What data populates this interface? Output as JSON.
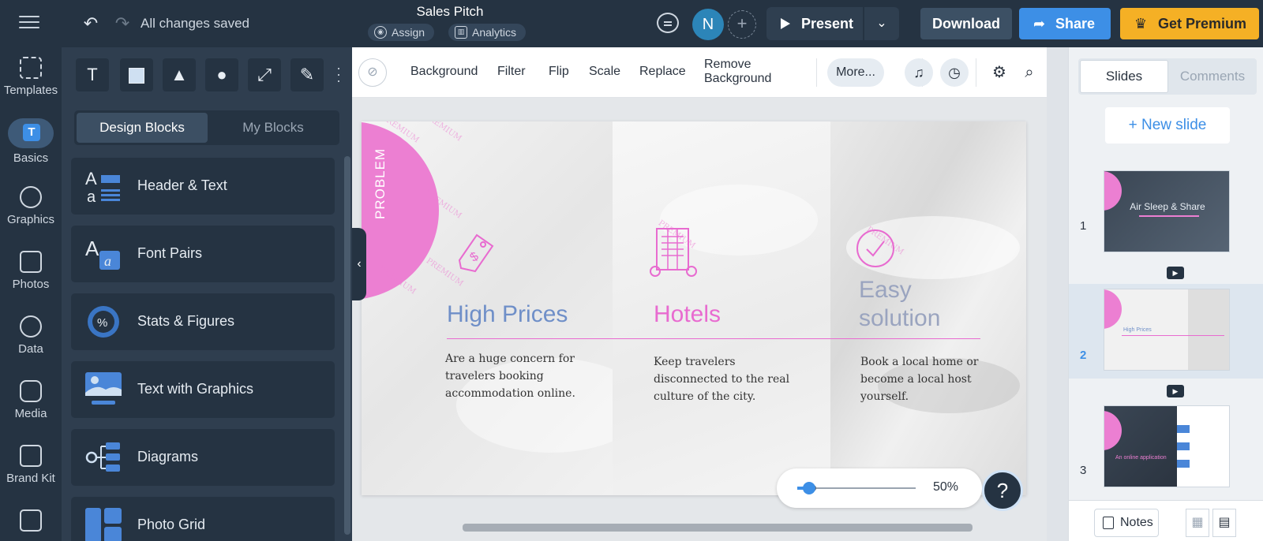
{
  "topbar": {
    "save_status": "All changes saved",
    "doc_title": "Sales Pitch",
    "assign_label": "Assign",
    "analytics_label": "Analytics",
    "avatar_initial": "N",
    "present_label": "Present",
    "download_label": "Download",
    "share_label": "Share",
    "premium_label": "Get Premium"
  },
  "leftnav": {
    "items": [
      {
        "label": "Templates"
      },
      {
        "label": "Basics"
      },
      {
        "label": "Graphics"
      },
      {
        "label": "Photos"
      },
      {
        "label": "Data"
      },
      {
        "label": "Media"
      },
      {
        "label": "Brand Kit"
      }
    ]
  },
  "panel": {
    "tab_design": "Design Blocks",
    "tab_mine": "My Blocks",
    "blocks": [
      {
        "label": "Header & Text"
      },
      {
        "label": "Font Pairs"
      },
      {
        "label": "Stats & Figures"
      },
      {
        "label": "Text with Graphics"
      },
      {
        "label": "Diagrams"
      },
      {
        "label": "Photo Grid"
      }
    ]
  },
  "toolbar": {
    "background": "Background",
    "filter": "Filter",
    "flip": "Flip",
    "scale": "Scale",
    "replace": "Replace",
    "remove_bg_line1": "Remove",
    "remove_bg_line2": "Background",
    "more": "More..."
  },
  "slide": {
    "badge": "PROBLEM",
    "watermark": "PREMIUM",
    "col1_title": "High Prices",
    "col1_text": "Are a huge concern for travelers booking accommodation online.",
    "col2_title": "Hotels",
    "col2_text": "Keep travelers disconnected to the real culture of the city.",
    "col3_title_line1": "Easy",
    "col3_title_line2": "solution",
    "col3_text": "Book a local home or become a local host yourself."
  },
  "zoom": {
    "label": "50%",
    "value": 0.1
  },
  "help_label": "?",
  "rpanel": {
    "tab_slides": "Slides",
    "tab_comments": "Comments",
    "new_slide": "+ New slide",
    "slides": [
      {
        "num": "1",
        "title": "Air Sleep & Share"
      },
      {
        "num": "2",
        "title": "High Prices"
      },
      {
        "num": "3",
        "title": "An online application"
      }
    ],
    "notes_label": "Notes"
  },
  "colors": {
    "topbar": "#253342",
    "accent_blue": "#3d8fe6",
    "premium": "#f5b025",
    "pink": "#ec7fd2"
  }
}
